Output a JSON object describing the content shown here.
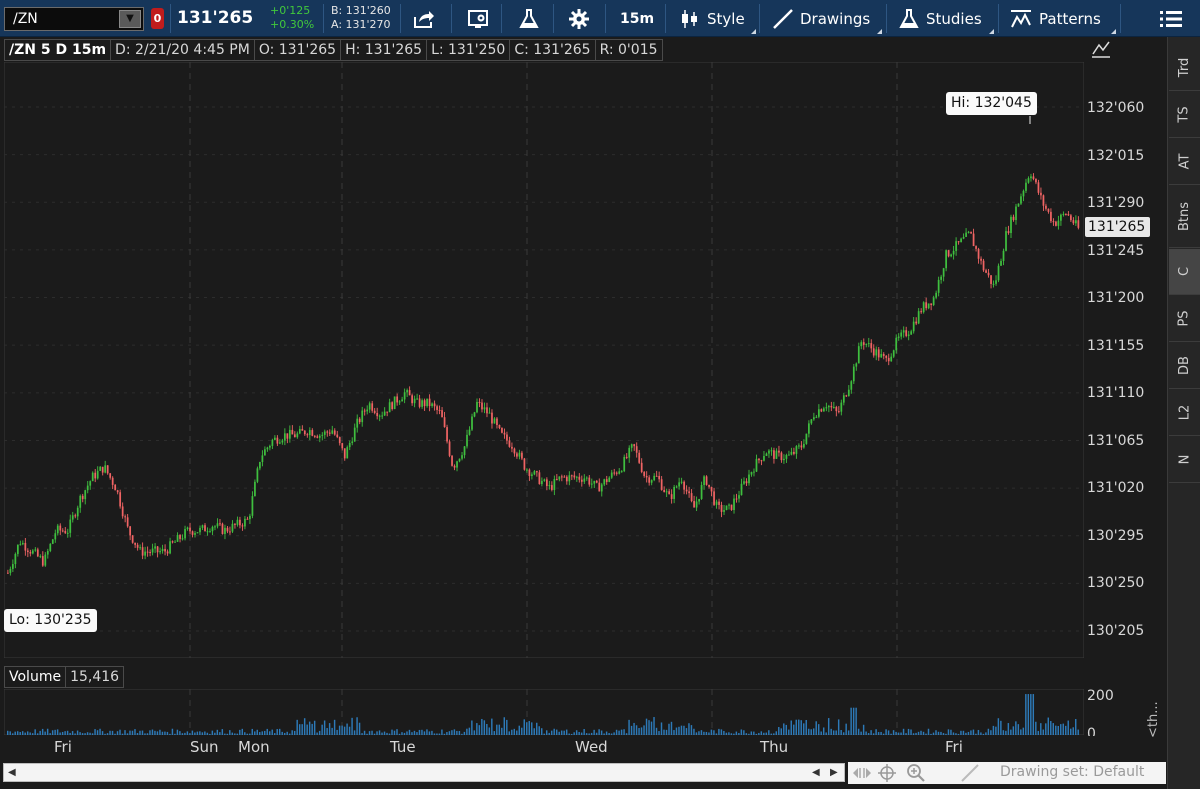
{
  "toolbar": {
    "symbol": "/ZN",
    "alert_badge": "0",
    "last_price": "131'265",
    "net_change": "+0'125",
    "pct_change": "+0.30%",
    "bid": "B: 131'260",
    "ask": "A: 131'270",
    "timeframe": "15m",
    "style_label": "Style",
    "drawings_label": "Drawings",
    "studies_label": "Studies",
    "patterns_label": "Patterns"
  },
  "side_tabs": [
    {
      "label": "Trd"
    },
    {
      "label": "TS"
    },
    {
      "label": "AT"
    },
    {
      "label": "Btns"
    },
    {
      "label": "C",
      "selected": true
    },
    {
      "label": "PS"
    },
    {
      "label": "DB"
    },
    {
      "label": "L2"
    },
    {
      "label": "N"
    }
  ],
  "chart_header": {
    "instrument": "/ZN 5 D 15m",
    "date": "D: 2/21/20 4:45 PM",
    "open": "O: 131'265",
    "high": "H: 131'265",
    "low": "L: 131'250",
    "close": "C: 131'265",
    "range": "R: 0'015"
  },
  "price_axis": {
    "labels": [
      "132'060",
      "132'015",
      "131'290",
      "131'245",
      "131'200",
      "131'155",
      "131'110",
      "131'065",
      "131'020",
      "130'295",
      "130'250",
      "130'205"
    ],
    "last_tag": "131'265"
  },
  "annotations": {
    "hi": "Hi: 132'045",
    "lo": "Lo: 130'235"
  },
  "volume": {
    "label": "Volume",
    "value": "15,416",
    "axis_top": "200",
    "axis_bottom": "0",
    "side_text": "<th..."
  },
  "time_axis": [
    "Fri",
    "Sun",
    "Mon",
    "Tue",
    "Wed",
    "Thu",
    "Fri"
  ],
  "bottom_bar": {
    "drawing_set": "Drawing set: Default"
  },
  "colors": {
    "up": "#3fbf3f",
    "down": "#f06464",
    "volume": "#2d7ab8",
    "background": "#1b1b1b",
    "toolbar": "#16365a"
  },
  "chart_data": {
    "type": "candlestick",
    "interval": "15m",
    "ylim": [
      130.205,
      132.08
    ],
    "x_sessions": [
      "Fri",
      "Sun",
      "Mon",
      "Tue",
      "Wed",
      "Thu",
      "Fri"
    ],
    "close_path": [
      130.26,
      130.29,
      130.28,
      130.27,
      130.3,
      130.3,
      130.33,
      130.35,
      130.36,
      130.34,
      130.3,
      130.28,
      130.28,
      130.28,
      130.29,
      130.3,
      130.3,
      130.305,
      130.3,
      130.305,
      130.31,
      130.37,
      130.385,
      130.39,
      130.39,
      130.395,
      130.39,
      130.395,
      131.05,
      131.08,
      131.1,
      131.09,
      131.1,
      131.11,
      131.1,
      131.1,
      131.09,
      131.04,
      131.06,
      131.1,
      131.09,
      131.07,
      131.06,
      131.04,
      131.03,
      131.02,
      131.03,
      131.03,
      131.03,
      131.02,
      131.03,
      131.04,
      131.06,
      131.03,
      131.03,
      131.01,
      131.03,
      131.0,
      131.03,
      131.0,
      131.0,
      131.02,
      131.04,
      131.055,
      131.05,
      131.05,
      131.06,
      131.09,
      131.1,
      131.09,
      131.12,
      131.16,
      131.15,
      131.14,
      131.16,
      131.17,
      131.19,
      131.2,
      131.24,
      131.25,
      131.26,
      131.23,
      131.21,
      131.26,
      131.29,
      132.0,
      131.29,
      131.27,
      131.28,
      131.265
    ],
    "high": "132'045",
    "low": "130'235",
    "last": "131'265",
    "volume_axis": [
      0,
      200
    ]
  }
}
